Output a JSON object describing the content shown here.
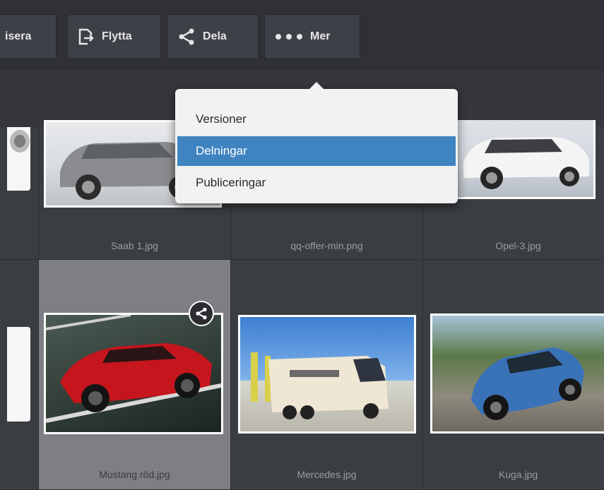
{
  "toolbar": {
    "buttons": [
      {
        "label": "isera",
        "icon": "none"
      },
      {
        "label": "Flytta",
        "icon": "move-icon"
      },
      {
        "label": "Dela",
        "icon": "share-icon"
      },
      {
        "label": "Mer",
        "icon": "more-dots-icon"
      }
    ]
  },
  "menu": {
    "items": [
      {
        "label": "Versioner",
        "active": false
      },
      {
        "label": "Delningar",
        "active": true
      },
      {
        "label": "Publiceringar",
        "active": false
      }
    ]
  },
  "grid": {
    "row1": [
      {
        "caption": ""
      },
      {
        "caption": "Saab 1.jpg"
      },
      {
        "caption": "qq-offer-min.png"
      },
      {
        "caption": "Opel-3.jpg"
      }
    ],
    "row2": [
      {
        "caption": ""
      },
      {
        "caption": "Mustang röd.jpg",
        "selected": true,
        "shared": true
      },
      {
        "caption": "Mercedes.jpg"
      },
      {
        "caption": "Kuga.jpg"
      }
    ]
  },
  "colors": {
    "accent": "#3f84c0",
    "background": "#3a3d42",
    "toolbar": "#2f3136"
  }
}
